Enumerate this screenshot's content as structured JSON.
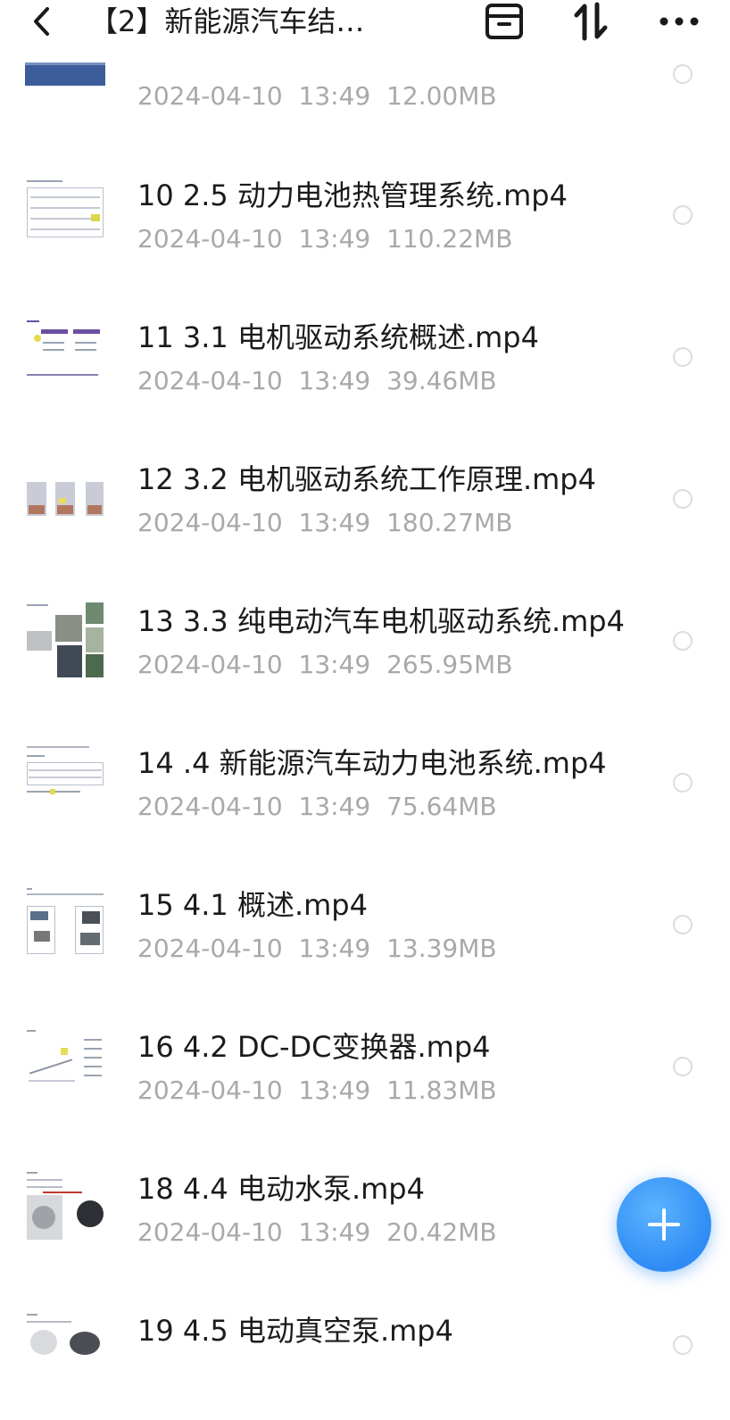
{
  "header": {
    "back_icon": "chevron-left-icon",
    "title": "【2】新能源汽车结…",
    "archive_icon": "archive-box-icon",
    "sort_icon": "sort-arrows-icon",
    "more_icon": "more-dots-icon"
  },
  "files": [
    {
      "name": "",
      "date": "2024-04-10",
      "time": "13:49",
      "size": "12.00MB",
      "thumb": "blue-chart-thumbnail"
    },
    {
      "name": "10 2.5 动力电池热管理系统.mp4",
      "date": "2024-04-10",
      "time": "13:49",
      "size": "110.22MB",
      "thumb": "table-slide-thumbnail"
    },
    {
      "name": "11 3.1 电机驱动系统概述.mp4",
      "date": "2024-04-10",
      "time": "13:49",
      "size": "39.46MB",
      "thumb": "diagram-slide-thumbnail"
    },
    {
      "name": "12 3.2 电机驱动系统工作原理.mp4",
      "date": "2024-04-10",
      "time": "13:49",
      "size": "180.27MB",
      "thumb": "motor-diagram-thumbnail"
    },
    {
      "name": "13 3.3 纯电动汽车电机驱动系统.mp4",
      "date": "2024-04-10",
      "time": "13:49",
      "size": "265.95MB",
      "thumb": "photo-collage-thumbnail"
    },
    {
      "name": "14 .4 新能源汽车动力电池系统.mp4",
      "date": "2024-04-10",
      "time": "13:49",
      "size": "75.64MB",
      "thumb": "table-slide-thumbnail"
    },
    {
      "name": "15 4.1 概述.mp4",
      "date": "2024-04-10",
      "time": "13:49",
      "size": "13.39MB",
      "thumb": "components-slide-thumbnail"
    },
    {
      "name": "16 4.2 DC-DC变换器.mp4",
      "date": "2024-04-10",
      "time": "13:49",
      "size": "11.83MB",
      "thumb": "graph-slide-thumbnail"
    },
    {
      "name": "18 4.4 电动水泵.mp4",
      "date": "2024-04-10",
      "time": "13:49",
      "size": "20.42MB",
      "thumb": "pump-slide-thumbnail"
    },
    {
      "name": "19 4.5 电动真空泵.mp4",
      "date": "",
      "time": "",
      "size": "",
      "thumb": "vacuum-pump-thumbnail"
    }
  ],
  "fab": {
    "icon": "plus-icon"
  },
  "colors": {
    "accent": "#2e8cf4",
    "meta_text": "#a9a9a9",
    "title_text": "#1b1b1b"
  }
}
